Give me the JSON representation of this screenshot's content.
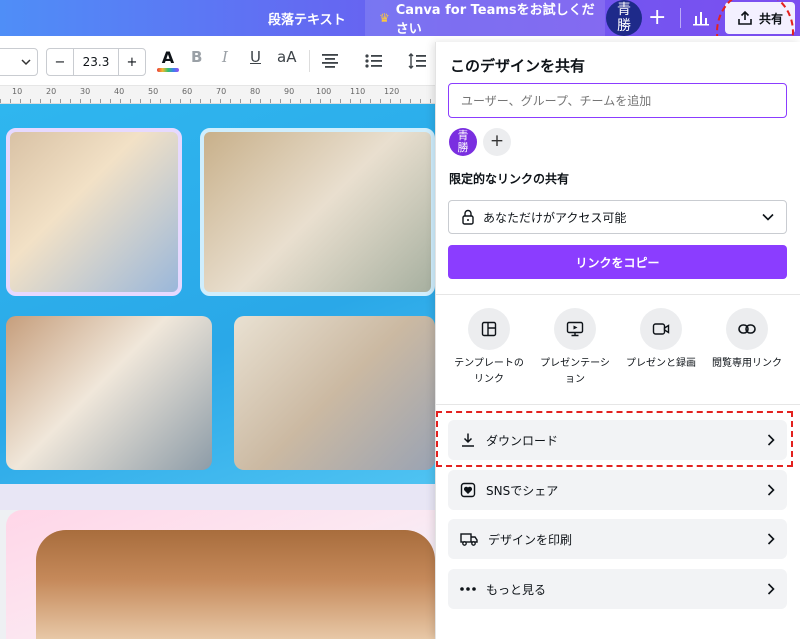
{
  "topbar": {
    "paragraph_text": "段落テキスト",
    "teams_label": "Canva for Teamsをお試しください",
    "avatar_text": "青\n勝",
    "add_label": "+",
    "share_label": "共有"
  },
  "toolbar": {
    "font_size": "23.3",
    "minus": "−",
    "plus": "+",
    "color_letter": "A",
    "bold": "B",
    "italic": "I",
    "underline": "U",
    "case": "aA"
  },
  "ruler": {
    "marks": [
      "10",
      "20",
      "30",
      "40",
      "50",
      "60",
      "70",
      "80",
      "90",
      "100",
      "110",
      "120"
    ]
  },
  "share_panel": {
    "title": "このデザインを共有",
    "input_placeholder": "ユーザー、グループ、チームを追加",
    "avatar_text": "青\n勝",
    "add_label": "+",
    "link_section_label": "限定的なリンクの共有",
    "access_value": "あなただけがアクセス可能",
    "copy_button": "リンクをコピー",
    "options": [
      {
        "label": "テンプレートの\nリンク",
        "icon": "template-icon"
      },
      {
        "label": "プレゼンテーシ\nョン",
        "icon": "presentation-icon"
      },
      {
        "label": "プレゼンと録画",
        "icon": "record-icon"
      },
      {
        "label": "閲覧専用リンク",
        "icon": "link-icon"
      }
    ],
    "rows": [
      {
        "label": "ダウンロード",
        "icon": "download-icon"
      },
      {
        "label": "SNSでシェア",
        "icon": "heart-icon"
      },
      {
        "label": "デザインを印刷",
        "icon": "truck-icon"
      },
      {
        "label": "もっと見る",
        "icon": "more-icon"
      }
    ]
  },
  "colors": {
    "accent": "#8b3dff",
    "highlight": "#e3211f"
  }
}
